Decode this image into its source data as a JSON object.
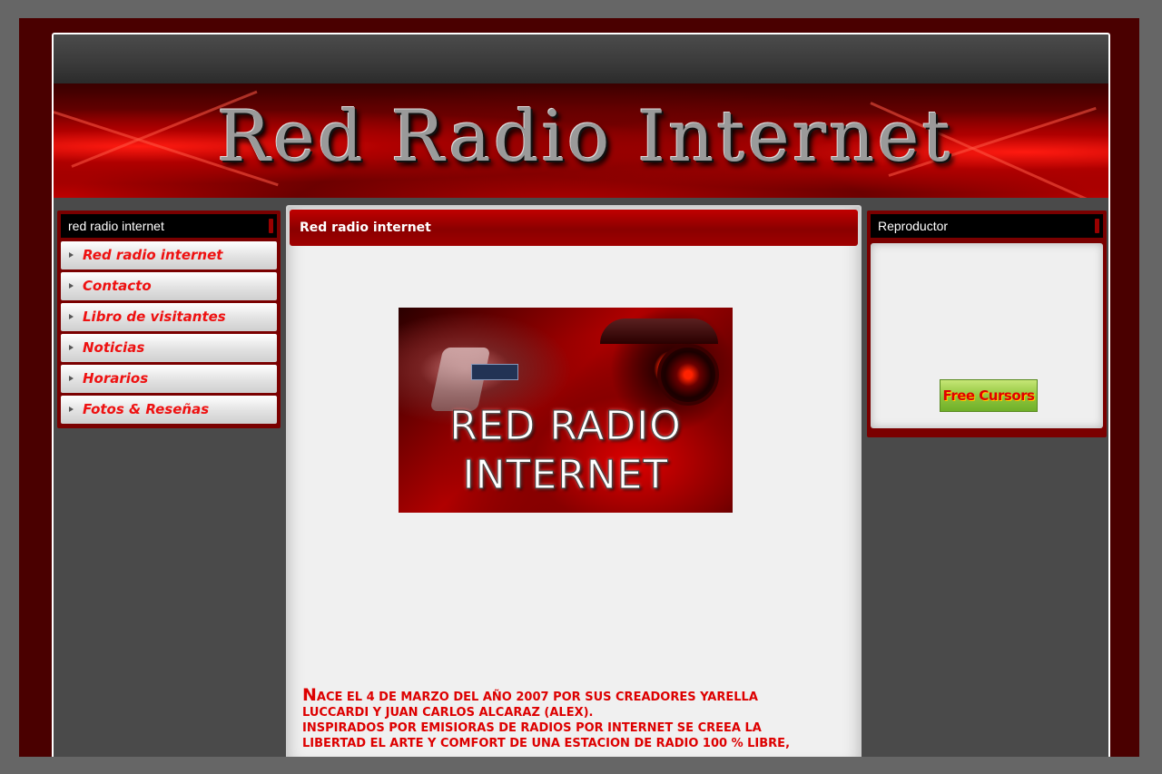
{
  "banner": {
    "title": "Red Radio Internet"
  },
  "sidebar": {
    "header": "red radio internet",
    "items": [
      {
        "label": "Red radio internet"
      },
      {
        "label": "Contacto"
      },
      {
        "label": "Libro de visitantes"
      },
      {
        "label": "Noticias"
      },
      {
        "label": "Horarios"
      },
      {
        "label": "Fotos & Reseñas"
      }
    ]
  },
  "main": {
    "header": "Red radio internet",
    "image_text_line1": "RED RADIO",
    "image_text_line2": "INTERNET",
    "text_dropcap": "N",
    "text_line1": "ACE EL 4 DE MARZO DEL AÑO 2007 POR SUS CREADORES YARELLA",
    "text_line2": "LUCCARDI Y JUAN CARLOS ALCARAZ (ALEX).",
    "text_line3": "INSPIRADOS POR EMISIORAS DE RADIOS POR INTERNET SE CREEA LA",
    "text_line4": "LIBERTAD EL ARTE Y COMFORT DE UNA ESTACION DE RADIO 100 % LIBRE,"
  },
  "right_sidebar": {
    "header": "Reproductor",
    "badge_label": "Free Cursors"
  },
  "colors": {
    "accent_red": "#dd0000",
    "frame_dark_red": "#4a0000",
    "page_gray": "#4a4a4a"
  }
}
